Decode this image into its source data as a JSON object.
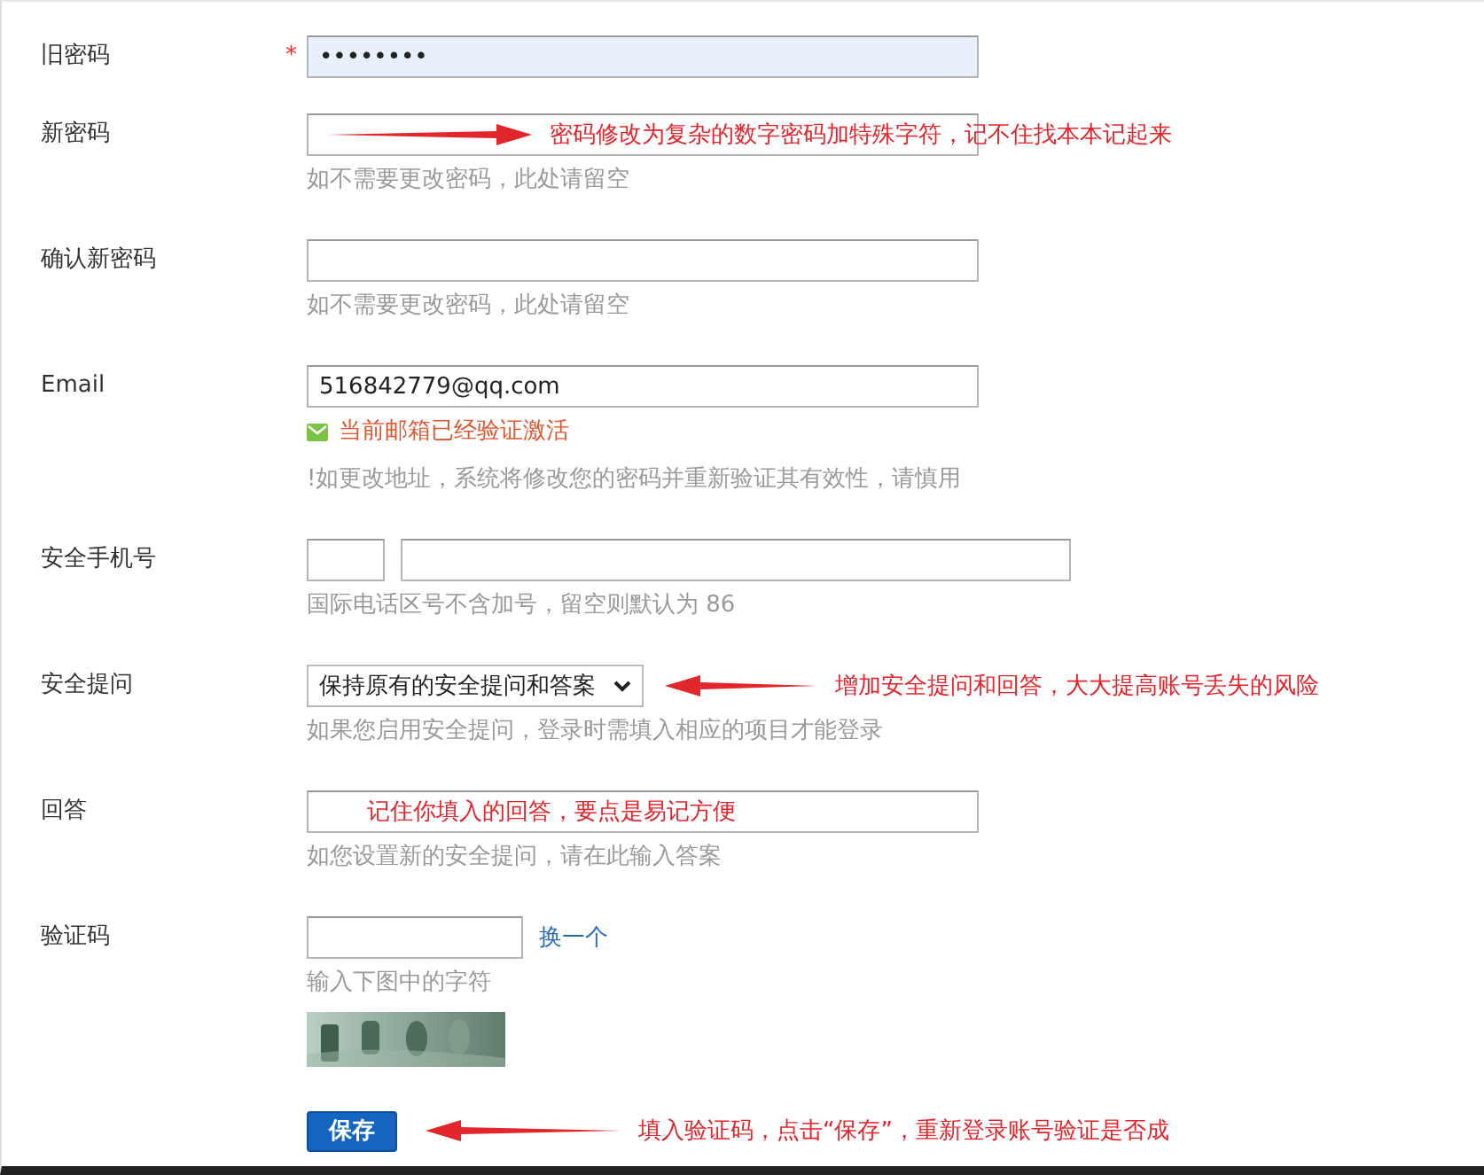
{
  "form": {
    "rows": [
      {
        "kind": "password",
        "label": "旧密码",
        "required_mark": "*",
        "value": "••••••••",
        "autofilled": true
      },
      {
        "kind": "password",
        "label": "新密码",
        "autofilled": false,
        "hints": [
          "如不需要更改密码，此处请留空"
        ],
        "annotation": {
          "text": "密码修改为复杂的数字密码加特殊字符，记不住找本本记起来",
          "arrow": true,
          "points_left": false
        }
      },
      {
        "kind": "password",
        "label": "确认新密码",
        "autofilled": false,
        "hints": [
          "如不需要更改密码，此处请留空"
        ]
      },
      {
        "kind": "text",
        "label": "Email",
        "value": "516842779@qq.com",
        "autofilled": false,
        "status": "当前邮箱已经验证激活",
        "hints": [
          "!如更改地址，系统将修改您的密码并重新验证其有效性，请慎用"
        ]
      },
      {
        "kind": "phone",
        "label": "安全手机号",
        "hints": [
          "国际电话区号不含加号，留空则默认为 86"
        ]
      },
      {
        "kind": "select",
        "label": "安全提问",
        "value": "保持原有的安全提问和答案",
        "hints": [
          "如果您启用安全提问，登录时需填入相应的项目才能登录"
        ],
        "annotation": {
          "text": "增加安全提问和回答，大大提高账号丢失的风险",
          "arrow": true,
          "points_left": true
        }
      },
      {
        "kind": "text",
        "label": "回答",
        "autofilled": false,
        "hints": [
          "如您设置新的安全提问，请在此输入答案"
        ],
        "annotation": {
          "text": "记住你填入的回答，要点是易记方便",
          "arrow": false
        }
      },
      {
        "kind": "captcha",
        "label": "验证码",
        "link": "换一个",
        "hints": [
          "输入下图中的字符"
        ]
      }
    ]
  },
  "save_button": {
    "label": "保存",
    "annotation": {
      "text": "填入验证码，点击“保存”，重新登录账号验证是否成",
      "arrow": true,
      "points_left": true
    }
  }
}
